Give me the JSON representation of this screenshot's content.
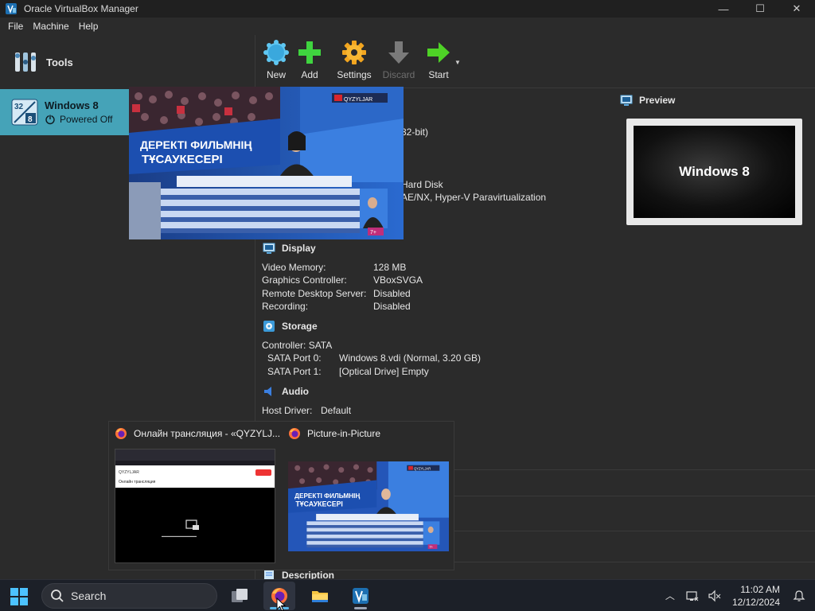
{
  "window": {
    "title": "Oracle VirtualBox Manager",
    "controls": [
      "—",
      "☐",
      "✕"
    ]
  },
  "menu": {
    "items": [
      "File",
      "Machine",
      "Help"
    ]
  },
  "sidebar": {
    "tools_label": "Tools",
    "vm": {
      "name": "Windows 8",
      "state": "Powered Off"
    }
  },
  "toolbar": {
    "new": "New",
    "add": "Add",
    "settings": "Settings",
    "discard": "Discard",
    "start": "Start"
  },
  "details": {
    "general_partial": {
      "os_fragment": "32-bit)",
      "boot_fragment": "Hard Disk",
      "accel_fragment": "AE/NX, Hyper-V Paravirtualization"
    },
    "display": {
      "title": "Display",
      "rows": [
        {
          "label": "Video Memory:",
          "value": "128 MB"
        },
        {
          "label": "Graphics Controller:",
          "value": "VBoxSVGA"
        },
        {
          "label": "Remote Desktop Server:",
          "value": "Disabled"
        },
        {
          "label": "Recording:",
          "value": "Disabled"
        }
      ]
    },
    "storage": {
      "title": "Storage",
      "controller": "Controller: SATA",
      "rows": [
        {
          "label": "SATA Port 0:",
          "value": "Windows 8.vdi (Normal, 3.20 GB)"
        },
        {
          "label": "SATA Port 1:",
          "value": "[Optical Drive] Empty"
        }
      ]
    },
    "audio": {
      "title": "Audio",
      "rows": [
        {
          "label": "Host Driver:",
          "value": "Default"
        }
      ]
    },
    "hidden_fragment": ")",
    "description_title": "Description"
  },
  "preview": {
    "title": "Preview",
    "screen_text": "Windows 8"
  },
  "pip_video": {
    "channel_badge": "QYZYLJAR",
    "banner_line1": "ДЕРЕКТІ ФИЛЬМНІҢ",
    "banner_line2": "ТҰСАУКЕСЕРІ",
    "age_badge": "7+"
  },
  "thumbnail_popup": {
    "left_title": "Онлайн трансляция - «QYZYLJ...",
    "right_title": "Picture-in-Picture",
    "left_site_logo": "QYZYLJAR",
    "left_site_heading": "Онлайн трансляция"
  },
  "taskbar": {
    "search_placeholder": "Search",
    "time": "11:02 AM",
    "date": "12/12/2024"
  }
}
